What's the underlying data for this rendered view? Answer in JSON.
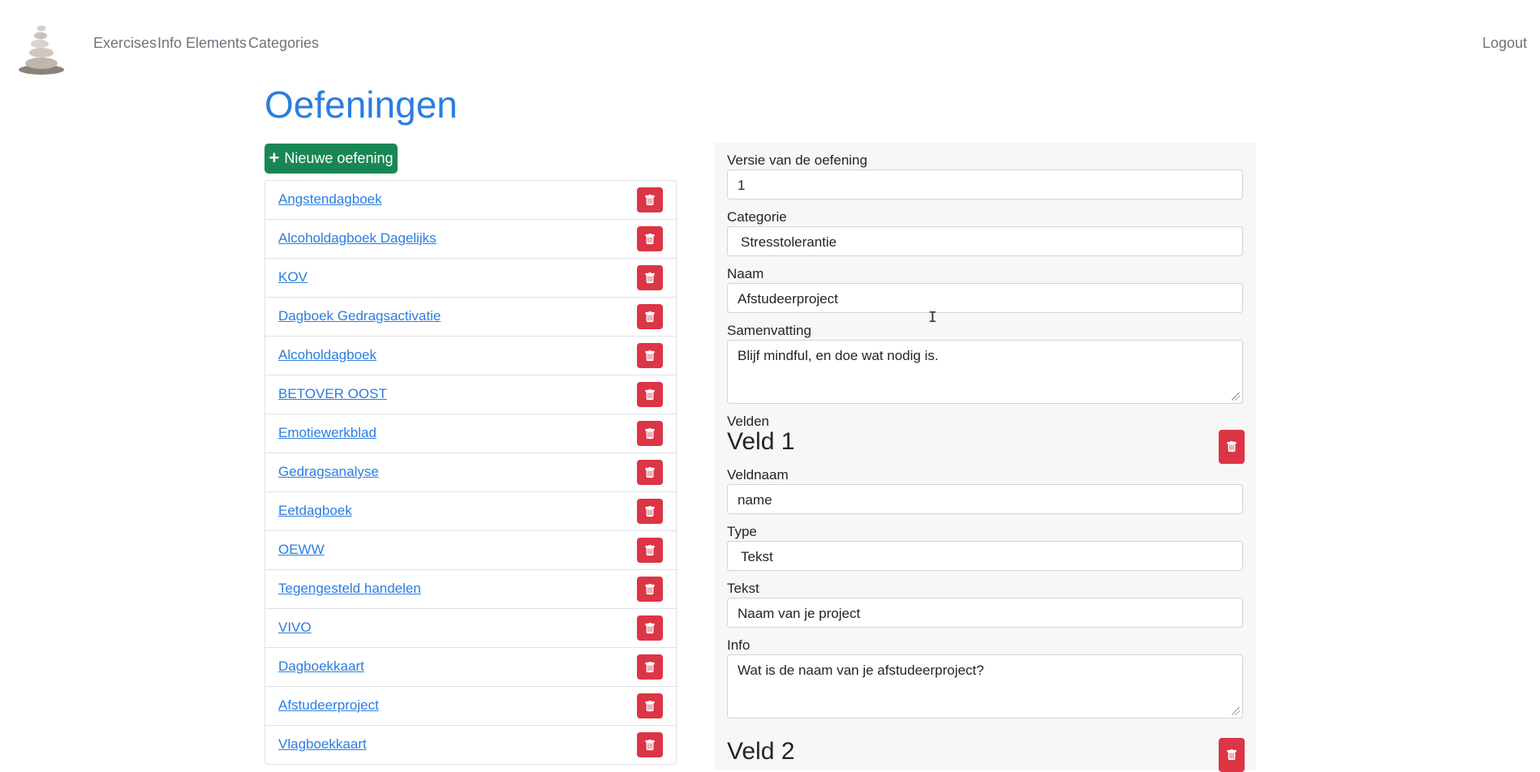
{
  "nav": {
    "links": [
      "Exercises",
      "Info Elements",
      "Categories"
    ],
    "logout": "Logout"
  },
  "page": {
    "title": "Oefeningen",
    "new_button": "Nieuwe oefening"
  },
  "exercises": [
    "Angstendagboek",
    "Alcoholdagboek Dagelijks",
    "KOV",
    "Dagboek Gedragsactivatie",
    "Alcoholdagboek",
    "BETOVER OOST",
    "Emotiewerkblad",
    "Gedragsanalyse",
    "Eetdagboek",
    "OEWW",
    "Tegengesteld handelen",
    "VIVO",
    "Dagboekkaart",
    "Afstudeerproject",
    "Vlagboekkaart"
  ],
  "form": {
    "version_label": "Versie van de oefening",
    "version_value": "1",
    "category_label": "Categorie",
    "category_value": "Stresstolerantie",
    "name_label": "Naam",
    "name_value": "Afstudeerproject",
    "summary_label": "Samenvatting",
    "summary_value": "Blijf mindful, en doe wat nodig is.",
    "fields_label": "Velden",
    "field1": {
      "title": "Veld 1",
      "fieldname_label": "Veldnaam",
      "fieldname_value": "name",
      "type_label": "Type",
      "type_value": "Tekst",
      "text_label": "Tekst",
      "text_value": "Naam van je project",
      "info_label": "Info",
      "info_value": "Wat is de naam van je afstudeerproject?"
    },
    "field2": {
      "title": "Veld 2"
    }
  },
  "colors": {
    "primary": "#2b7de0",
    "success": "#198754",
    "danger": "#dc3545",
    "nav_text": "#6c757d",
    "panel_bg": "#f7f7f7"
  },
  "icons": {
    "delete": "trash-icon",
    "add": "plus-icon",
    "logo": "stacked-stones-logo"
  }
}
